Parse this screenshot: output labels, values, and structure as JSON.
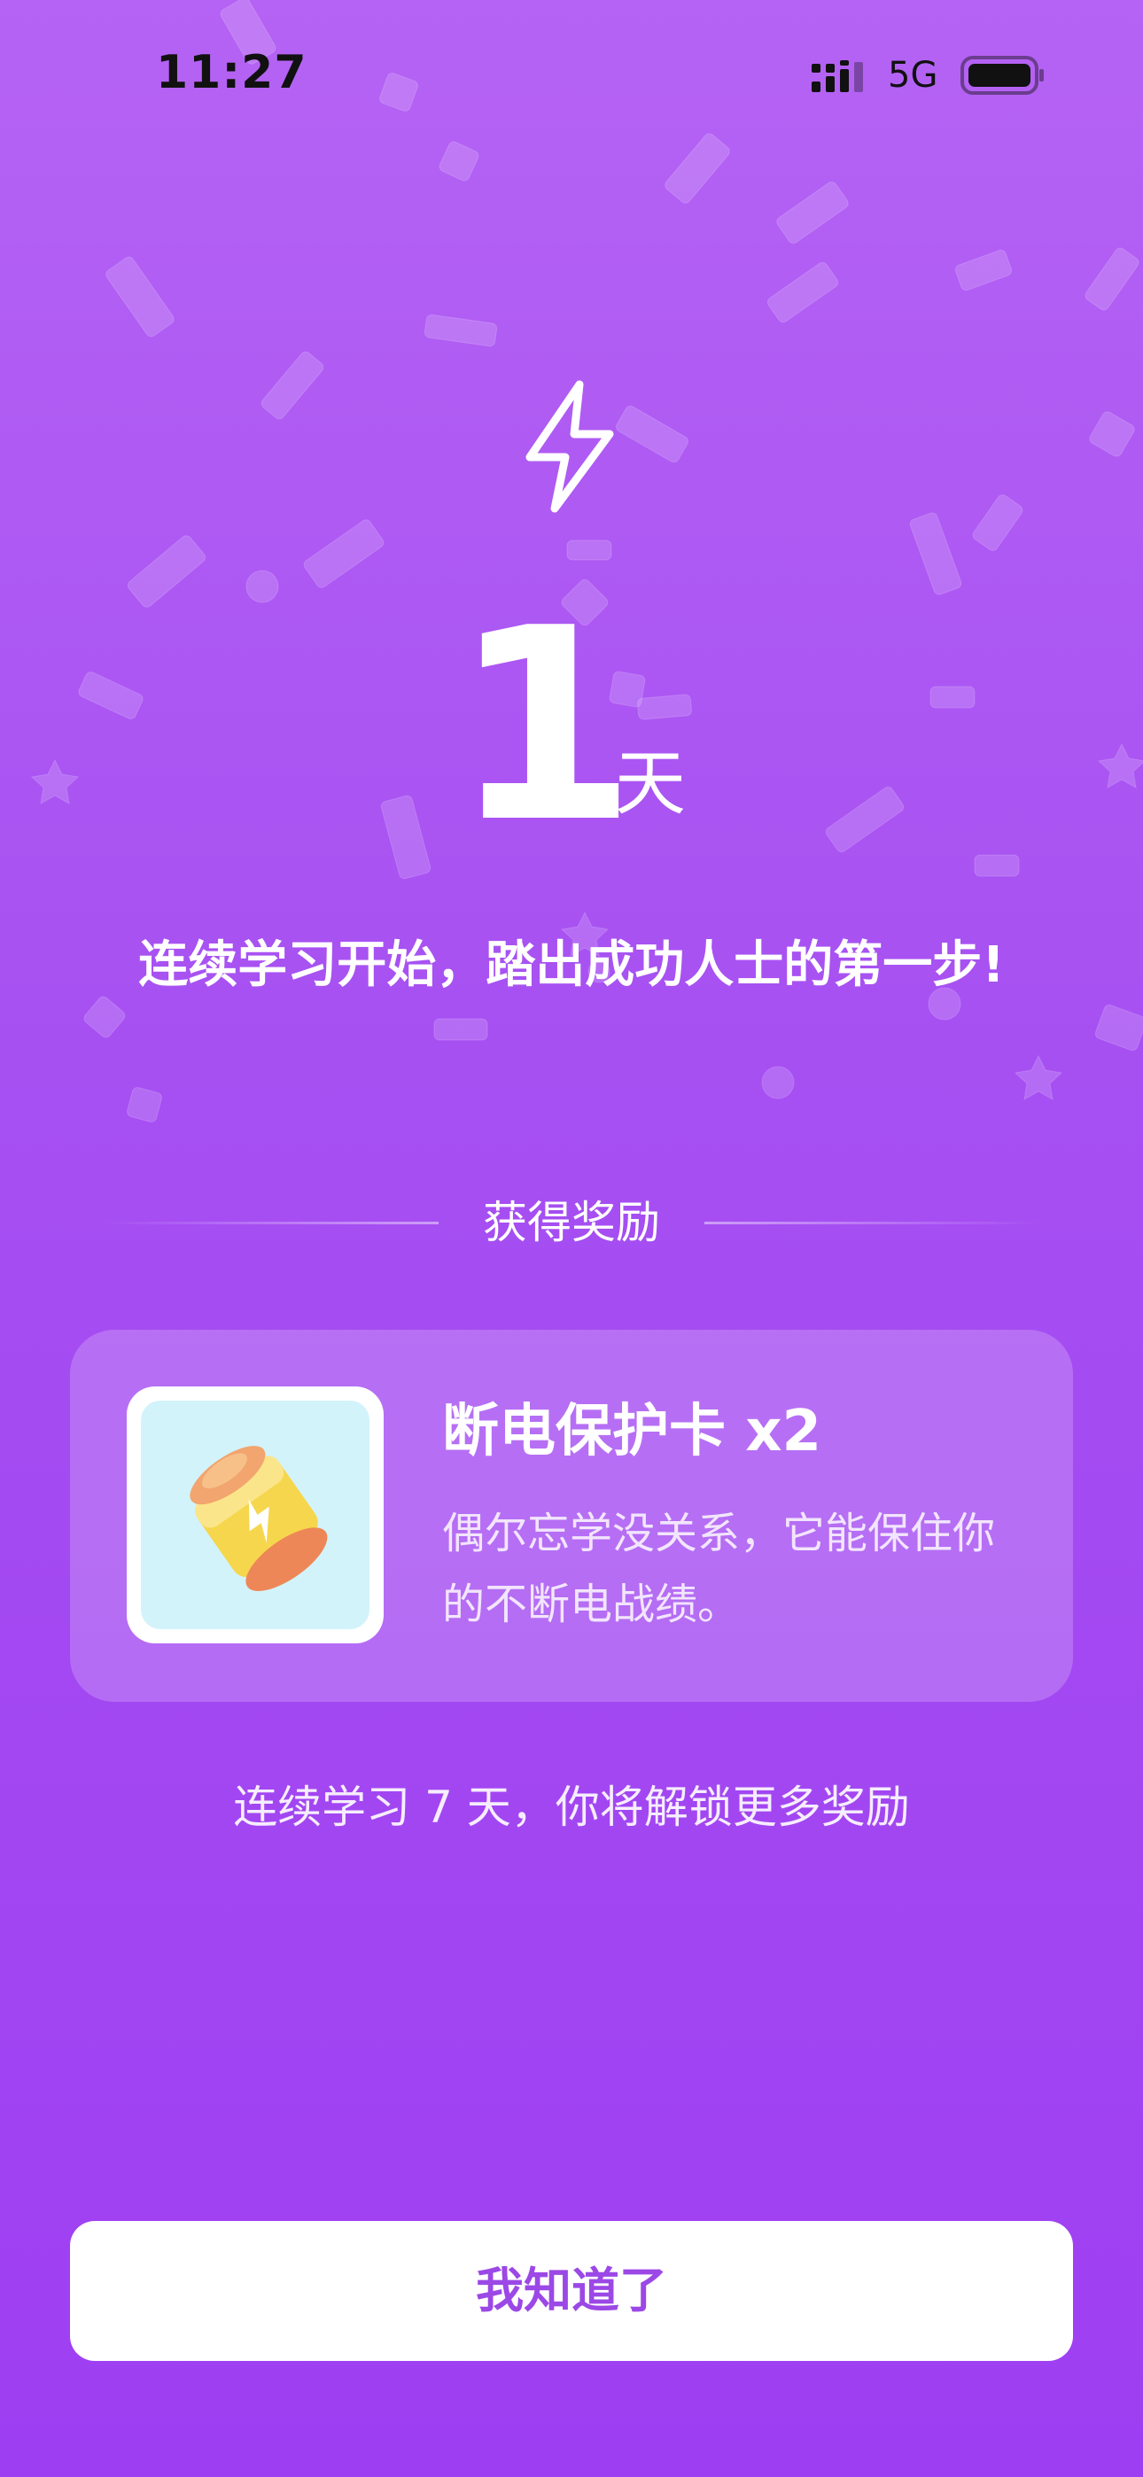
{
  "status_bar": {
    "time": "11:27",
    "network": "5G",
    "icons": [
      "signal-icon",
      "battery-icon"
    ]
  },
  "hero": {
    "icon": "lightning-bolt-icon",
    "streak_count": "1",
    "streak_unit": "天",
    "headline": "连续学习开始，踏出成功人士的第一步!"
  },
  "reward": {
    "section_label": "获得奖励",
    "item": {
      "icon": "battery-card-icon",
      "title": "断电保护卡 x2",
      "description": "偶尔忘学没关系，它能保住你的不断电战绩。"
    }
  },
  "unlock_hint": "连续学习 7 天，你将解锁更多奖励",
  "confirm_button": {
    "label": "我知道了"
  },
  "colors": {
    "background_top": "#b563f4",
    "background_bottom": "#9e3ef2",
    "button_text": "#9b48e6",
    "card_fill": "rgba(255,255,255,0.2)",
    "thumb_fill": "#d3f3fb"
  }
}
